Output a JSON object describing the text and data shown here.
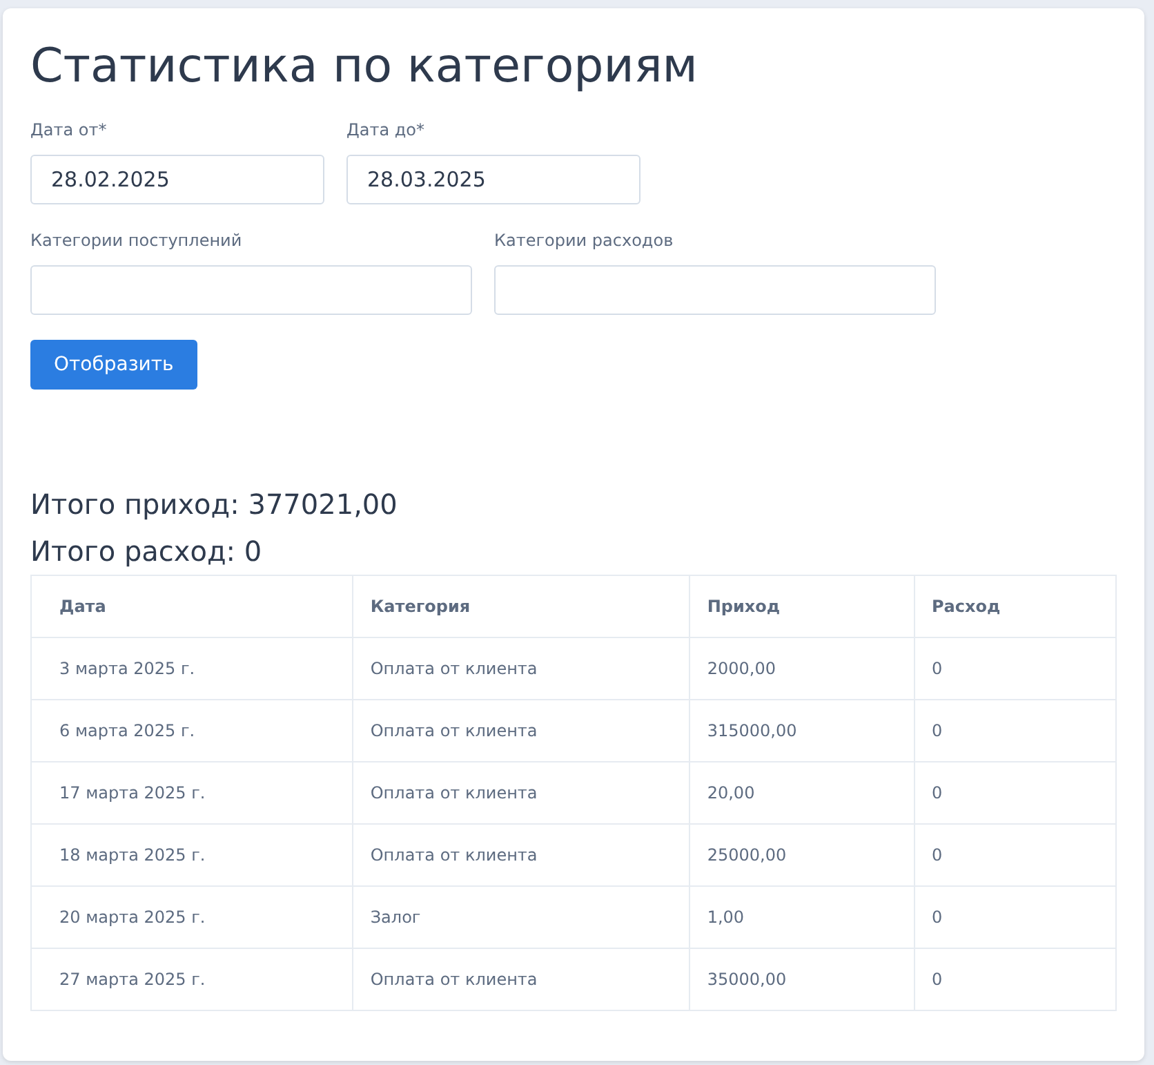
{
  "title": "Статистика по категориям",
  "date_fields": [
    {
      "label": "Дата от*",
      "value": "28.02.2025"
    },
    {
      "label": "Дата до*",
      "value": "28.03.2025"
    }
  ],
  "category_fields": [
    {
      "label": "Категории поступлений"
    },
    {
      "label": "Категории расходов"
    }
  ],
  "button": "Отобразить",
  "totals": [
    "Итого приход: 377021,00",
    "Итого расход: 0"
  ],
  "table": {
    "columns": [
      "Дата",
      "Категория",
      "Приход",
      "Расход"
    ],
    "rows": [
      [
        "3 марта 2025 г.",
        "Оплата от клиента",
        "2000,00",
        "0"
      ],
      [
        "6 марта 2025 г.",
        "Оплата от клиента",
        "315000,00",
        "0"
      ],
      [
        "17 марта 2025 г.",
        "Оплата от клиента",
        "20,00",
        "0"
      ],
      [
        "18 марта 2025 г.",
        "Оплата от клиента",
        "25000,00",
        "0"
      ],
      [
        "20 марта 2025 г.",
        "Залог",
        "1,00",
        "0"
      ],
      [
        "27 марта 2025 г.",
        "Оплата от клиента",
        "35000,00",
        "0"
      ]
    ]
  }
}
